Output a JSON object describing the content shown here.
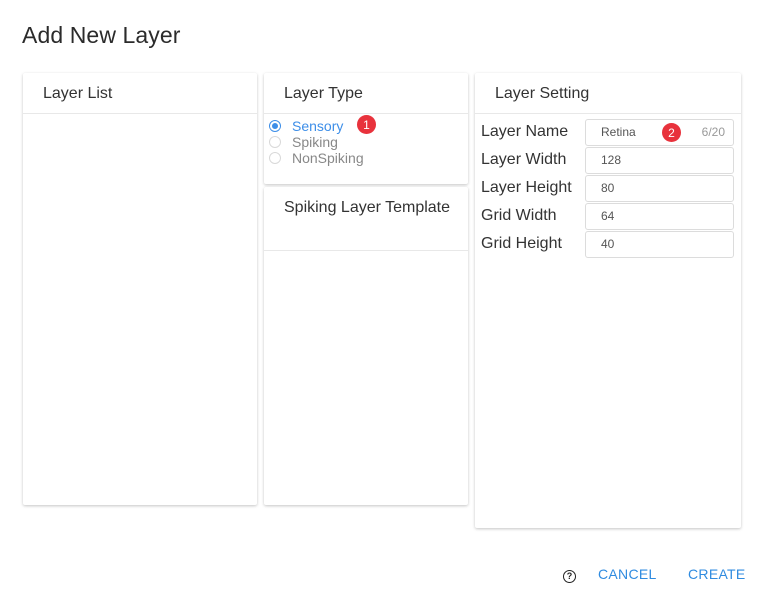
{
  "dialog": {
    "title": "Add New Layer"
  },
  "layer_list": {
    "header": "Layer List",
    "items": []
  },
  "layer_type": {
    "header": "Layer Type",
    "options": [
      {
        "label": "Sensory",
        "selected": true
      },
      {
        "label": "Spiking",
        "selected": false
      },
      {
        "label": "NonSpiking",
        "selected": false
      }
    ],
    "badge": "1"
  },
  "spiking_template": {
    "header": "Spiking Layer Template"
  },
  "layer_setting": {
    "header": "Layer Setting",
    "fields": [
      {
        "label": "Layer Name",
        "value": "Retina",
        "counter": "6/20"
      },
      {
        "label": "Layer Width",
        "value": "128"
      },
      {
        "label": "Layer Height",
        "value": "80"
      },
      {
        "label": "Grid Width",
        "value": "64"
      },
      {
        "label": "Grid Height",
        "value": "40"
      }
    ],
    "badge": "2"
  },
  "footer": {
    "help_icon": "question-circle-icon",
    "help_glyph": "?",
    "cancel": "CANCEL",
    "create": "CREATE"
  },
  "colors": {
    "accent": "#3d8ee8",
    "badge": "#e8323c",
    "link": "#2f8be0"
  }
}
